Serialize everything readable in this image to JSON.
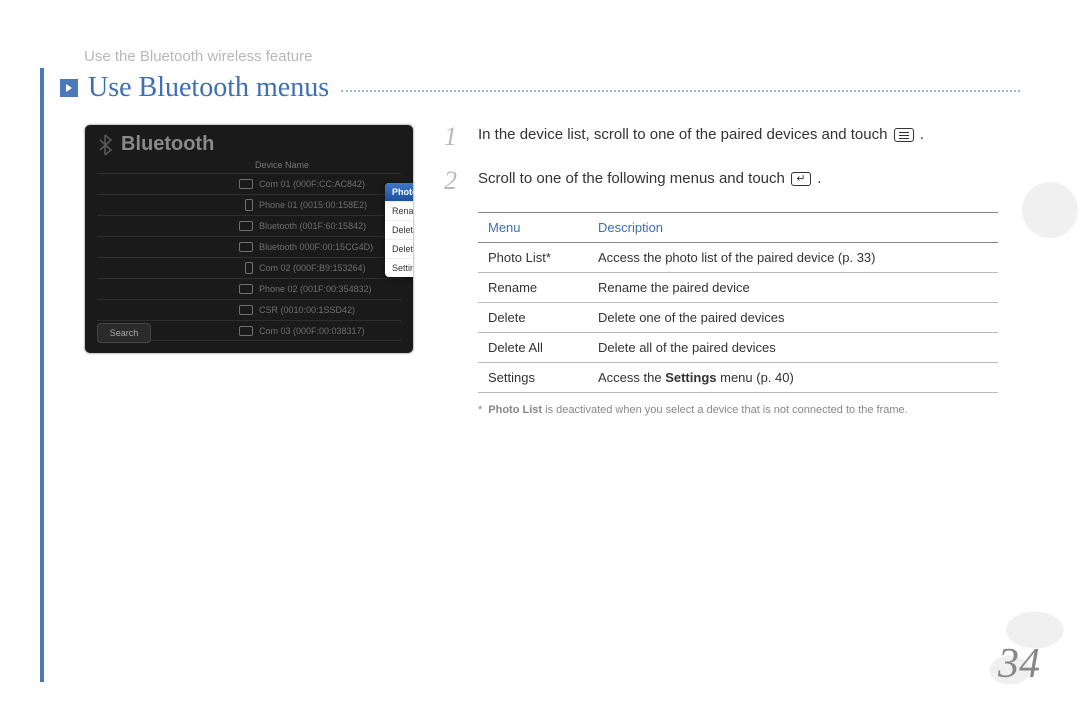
{
  "breadcrumb": "Use the Bluetooth wireless feature",
  "heading": "Use Bluetooth menus",
  "page_number": "34",
  "screenshot": {
    "title": "Bluetooth",
    "column_header": "Device Name",
    "search_label": "Search",
    "devices": [
      {
        "type": "computer",
        "name": "Com 01 (000F:CC:AC842)"
      },
      {
        "type": "phone",
        "name": "Phone 01 (0015:00:158E2)"
      },
      {
        "type": "computer",
        "name": "Bluetooth (001F:60:15842)"
      },
      {
        "type": "computer",
        "name": "Bluetooth 000F:00:15CG4D)"
      },
      {
        "type": "phone",
        "name": "Com 02 (000F:B9:153264)"
      },
      {
        "type": "computer",
        "name": "Phone 02 (001F:00:354832)"
      },
      {
        "type": "computer",
        "name": "CSR (0010:00:1SSD42)"
      },
      {
        "type": "computer",
        "name": "Com 03 (000F:00:038317)"
      }
    ],
    "context_menu": [
      "Photo List",
      "Rename",
      "Delete",
      "Delete All",
      "Settings"
    ]
  },
  "steps": {
    "s1": "In the device list, scroll to one of the paired devices and touch ",
    "s1_tail": ".",
    "s2": "Scroll to one of the following menus and touch ",
    "s2_tail": "."
  },
  "table": {
    "head_menu": "Menu",
    "head_desc": "Description",
    "rows": [
      {
        "menu": "Photo List*",
        "desc_pre": "Access the photo list of the paired device (p. ",
        "page": "33",
        "desc_post": ")"
      },
      {
        "menu": "Rename",
        "desc": "Rename the paired device"
      },
      {
        "menu": "Delete",
        "desc": "Delete one of the paired devices"
      },
      {
        "menu": "Delete All",
        "desc": "Delete all of the paired devices"
      },
      {
        "menu": "Settings",
        "desc_pre": "Access the ",
        "bold": "Settings",
        "desc_mid": " menu (p. ",
        "page": "40",
        "desc_post": ")"
      }
    ]
  },
  "footnote": {
    "ast": "*",
    "bold": "Photo List",
    "text": " is deactivated when you select a device that is not connected to the frame."
  }
}
